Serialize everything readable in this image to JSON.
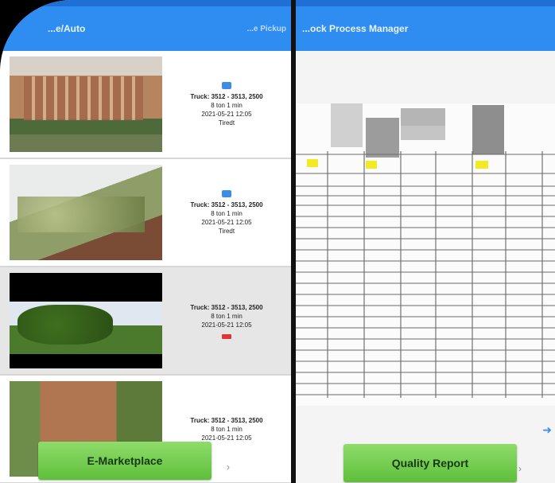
{
  "left_panel": {
    "app_title": "...e/Auto",
    "right_title": "...e Pickup",
    "items": [
      {
        "line1": "Truck: 3512 - 3513, 2500",
        "line2": "8 ton  1 min",
        "line3": "2021-05-21 12:05",
        "line4": "Tiredt",
        "has_camera": true,
        "has_delete": false,
        "thumb": "logs-truck"
      },
      {
        "line1": "Truck: 3512 - 3513, 2500",
        "line2": "8 ton  1 min",
        "line3": "2021-05-21 12:05",
        "line4": "Tiredt",
        "has_camera": true,
        "has_delete": false,
        "thumb": "leaf-truck"
      },
      {
        "line1": "Truck: 3512 - 3513, 2500",
        "line2": "8 ton  1 min",
        "line3": "2021-05-21 12:05",
        "line4": "",
        "has_camera": false,
        "has_delete": true,
        "thumb": "trees"
      },
      {
        "line1": "Truck: 3512 - 3513, 2500",
        "line2": "8 ton  1 min",
        "line3": "2021-05-21 12:05",
        "line4": "",
        "has_camera": false,
        "has_delete": false,
        "thumb": "logs-pile"
      }
    ],
    "button_label": "E-Marketplace"
  },
  "right_panel": {
    "app_title": "...ock Process Manager",
    "button_label": "Quality Report"
  },
  "colors": {
    "appbar": "#2f8cf0",
    "button": "#6fcd48",
    "delete": "#e0343a"
  }
}
